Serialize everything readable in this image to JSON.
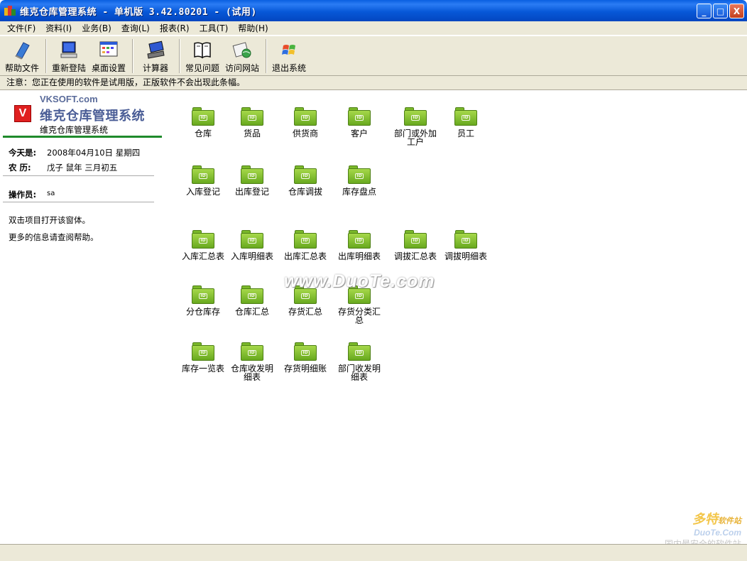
{
  "window": {
    "title": "维克仓库管理系统 - 单机版 3.42.80201 - (试用)",
    "controls": {
      "minimize": "_",
      "maximize": "□",
      "close": "X"
    }
  },
  "menu": [
    {
      "label": "文件(F)"
    },
    {
      "label": "资料(I)"
    },
    {
      "label": "业务(B)"
    },
    {
      "label": "查询(L)"
    },
    {
      "label": "报表(R)"
    },
    {
      "label": "工具(T)"
    },
    {
      "label": "帮助(H)"
    }
  ],
  "toolbar": [
    {
      "label": "帮助文件",
      "icon": "book-icon"
    },
    {
      "label": "重新登陆",
      "icon": "monitor-icon"
    },
    {
      "label": "桌面设置",
      "icon": "desktop-settings-icon"
    },
    {
      "label": "计算器",
      "icon": "calculator-icon"
    },
    {
      "label": "常见问题",
      "icon": "open-book-icon"
    },
    {
      "label": "访问网站",
      "icon": "globe-icon"
    },
    {
      "label": "退出系统",
      "icon": "windows-flag-icon"
    }
  ],
  "notice": "注意：您正在使用的软件是试用版，正版软件不会出现此条幅。",
  "left": {
    "domain": "VKSOFT.com",
    "logo_letter": "V",
    "title": "维克仓库管理系统",
    "subtitle": "维克仓库管理系统",
    "today_label": "今天是:",
    "today_value": "2008年04月10日  星期四",
    "lunar_label": "农   历:",
    "lunar_value": "戊子  鼠年  三月初五",
    "operator_label": "操作员:",
    "operator_value": "sa",
    "hint1": "双击项目打开该窗体。",
    "hint2": "更多的信息请查阅帮助。"
  },
  "icons": [
    {
      "label": "仓库"
    },
    {
      "label": "货品"
    },
    {
      "label": "供货商"
    },
    {
      "label": "客户"
    },
    {
      "label": "部门或外加工户"
    },
    {
      "label": "员工"
    },
    {
      "label": "入库登记"
    },
    {
      "label": "出库登记"
    },
    {
      "label": "仓库调拔"
    },
    {
      "label": "库存盘点"
    },
    {
      "label": "入库汇总表"
    },
    {
      "label": "入库明细表"
    },
    {
      "label": "出库汇总表"
    },
    {
      "label": "出库明细表"
    },
    {
      "label": "调拔汇总表"
    },
    {
      "label": "调拔明细表"
    },
    {
      "label": "分仓库存"
    },
    {
      "label": "仓库汇总"
    },
    {
      "label": "存货汇总"
    },
    {
      "label": "存货分类汇总"
    },
    {
      "label": "库存一览表"
    },
    {
      "label": "仓库收发明细表"
    },
    {
      "label": "存货明细账"
    },
    {
      "label": "部门收发明细表"
    }
  ],
  "folder_badge": "ID",
  "watermark": "www.DuoTe.com",
  "corner": {
    "brand": "多特",
    "brand_small": "软件站",
    "url": "DuoTe.Com",
    "tagline": "国内最安全的软件站"
  }
}
